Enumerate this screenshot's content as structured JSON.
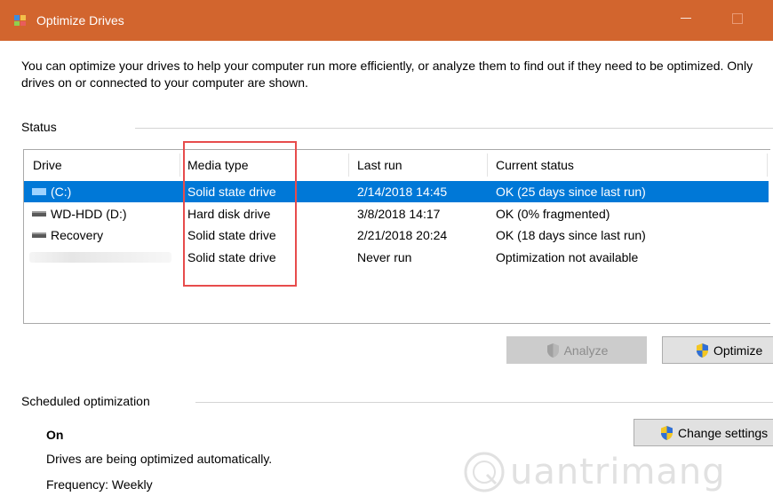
{
  "window": {
    "title": "Optimize Drives"
  },
  "intro_text": "You can optimize your drives to help your computer run more efficiently, or analyze them to find out if they need to be optimized. Only drives on or connected to your computer are shown.",
  "status_section": {
    "label": "Status",
    "columns": [
      "Drive",
      "Media type",
      "Last run",
      "Current status"
    ],
    "rows": [
      {
        "drive": "(C:)",
        "media_type": "Solid state drive",
        "last_run": "2/14/2018 14:45",
        "status": "OK (25 days since last run)",
        "selected": true
      },
      {
        "drive": "WD-HDD (D:)",
        "media_type": "Hard disk drive",
        "last_run": "3/8/2018 14:17",
        "status": "OK (0% fragmented)",
        "selected": false
      },
      {
        "drive": "Recovery",
        "media_type": "Solid state drive",
        "last_run": "2/21/2018 20:24",
        "status": "OK (18 days since last run)",
        "selected": false
      },
      {
        "drive": "",
        "media_type": "Solid state drive",
        "last_run": "Never run",
        "status": "Optimization not available",
        "selected": false
      }
    ],
    "analyze_label": "Analyze",
    "optimize_label": "Optimize"
  },
  "schedule_section": {
    "label": "Scheduled optimization",
    "state": "On",
    "description": "Drives are being optimized automatically.",
    "frequency": "Frequency: Weekly",
    "change_settings_label": "Change settings"
  },
  "watermark": {
    "text": "uantrimang"
  },
  "colors": {
    "titlebar": "#d2652e",
    "selection": "#0078d7",
    "annotation_box": "#e74c4c"
  }
}
